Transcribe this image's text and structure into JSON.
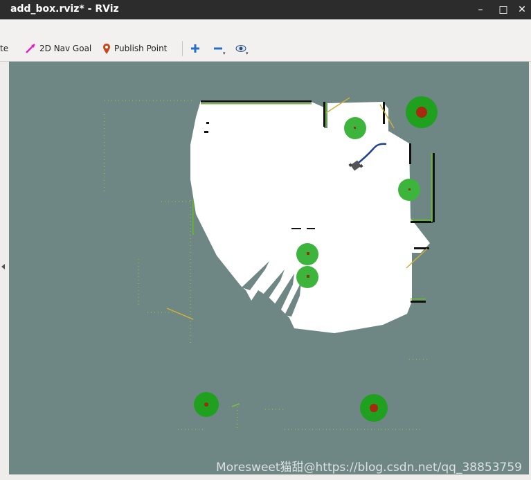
{
  "window": {
    "title": "add_box.rviz* - RViz"
  },
  "toolbar": {
    "partial_label": "te",
    "nav_goal_label": "2D Nav Goal",
    "publish_point_label": "Publish Point"
  },
  "watermark": "Moresweet猫甜@https://blog.csdn.net/qq_38853759",
  "colors": {
    "viewport_bg": "#6e8785",
    "free_space": "#ffffff",
    "marker_green": "#3db53d",
    "marker_dark_green": "#1fa01f",
    "marker_center": "#a52a10",
    "path_line": "#1f3f8f"
  }
}
